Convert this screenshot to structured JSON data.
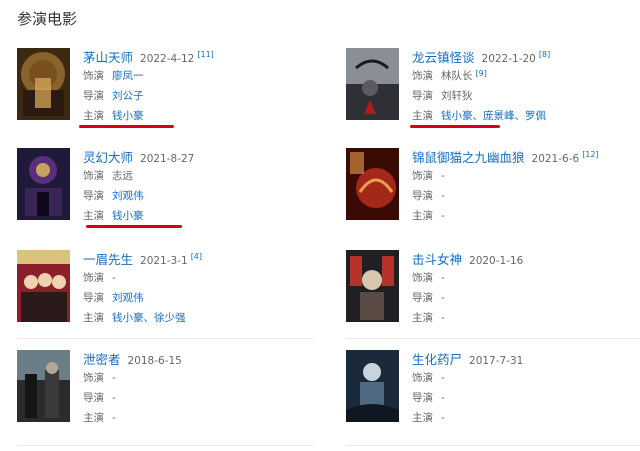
{
  "section": {
    "title": "参演电影"
  },
  "labels": {
    "role": "饰演",
    "director": "导演",
    "cast": "主演"
  },
  "movies": [
    {
      "title": "茅山天师",
      "date": "2022-4-12",
      "cite": "[11]",
      "role": "廖凤一",
      "director": "刘公子",
      "cast": "钱小豪",
      "poster_colors": [
        "#5c3b1c",
        "#c7953f",
        "#2a1a0f"
      ]
    },
    {
      "title": "龙云镇怪谈",
      "date": "2022-1-20",
      "cite": "[8]",
      "role": "林队长",
      "role_cite": "[9]",
      "director": "刘轩狄",
      "cast": "钱小豪、庞景峰、罗佩",
      "poster_colors": [
        "#8a8f96",
        "#2f2f36",
        "#b11b1b"
      ]
    },
    {
      "title": "灵幻大师",
      "date": "2021-8-27",
      "cite": "",
      "role": "志远",
      "director": "刘观伟",
      "cast": "钱小豪",
      "poster_colors": [
        "#1f1a3a",
        "#5a2e7a",
        "#e0c15a"
      ]
    },
    {
      "title": "锦鼠御猫之九幽血狼",
      "date": "2021-6-6",
      "cite": "[12]",
      "role": "-",
      "director": "-",
      "cast": "-",
      "poster_colors": [
        "#3a0a05",
        "#a3281a",
        "#e8a04a"
      ]
    },
    {
      "title": "一眉先生",
      "date": "2021-3-1",
      "cite": "[4]",
      "role": "-",
      "director": "刘观伟",
      "cast": "钱小豪、徐少强",
      "poster_colors": [
        "#8c1f2a",
        "#d9c27a",
        "#2a1a1a"
      ]
    },
    {
      "title": "击斗女神",
      "date": "2020-1-16",
      "cite": "",
      "role": "-",
      "director": "-",
      "cast": "-",
      "poster_colors": [
        "#201f24",
        "#b7322b",
        "#d8c7b0"
      ]
    },
    {
      "title": "泄密者",
      "date": "2018-6-15",
      "cite": "",
      "role": "-",
      "director": "-",
      "cast": "-",
      "poster_colors": [
        "#2b2b2b",
        "#6b7d87",
        "#b0a79a"
      ]
    },
    {
      "title": "生化药尸",
      "date": "2017-7-31",
      "cite": "",
      "role": "-",
      "director": "-",
      "cast": "-",
      "poster_colors": [
        "#1b2a3a",
        "#4f6a80",
        "#c9d3dc"
      ]
    }
  ],
  "underline_color": "#d9000f"
}
